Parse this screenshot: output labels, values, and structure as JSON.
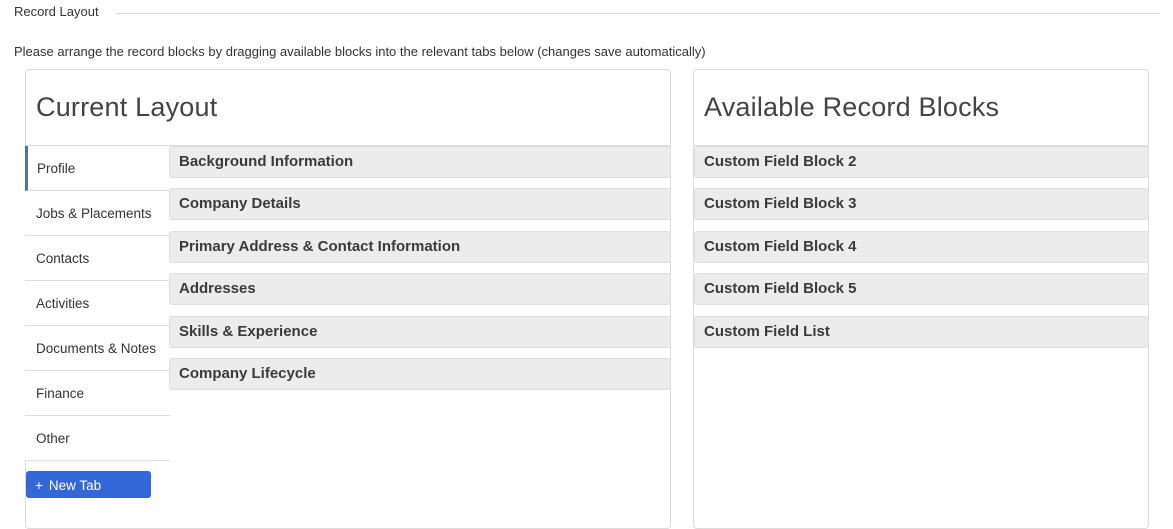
{
  "section": {
    "legend": "Record Layout",
    "instructions": "Please arrange the record blocks by dragging available blocks into the relevant tabs below (changes save automatically)"
  },
  "current_layout": {
    "title": "Current Layout",
    "tabs": [
      {
        "label": "Profile",
        "active": true
      },
      {
        "label": "Jobs & Placements",
        "active": false
      },
      {
        "label": "Contacts",
        "active": false
      },
      {
        "label": "Activities",
        "active": false
      },
      {
        "label": "Documents & Notes",
        "active": false
      },
      {
        "label": "Finance",
        "active": false
      },
      {
        "label": "Other",
        "active": false
      }
    ],
    "new_tab_button": {
      "icon": "+",
      "label": "New Tab"
    },
    "blocks": [
      "Background Information",
      "Company Details",
      "Primary Address & Contact Information",
      "Addresses",
      "Skills & Experience",
      "Company Lifecycle"
    ]
  },
  "available_blocks": {
    "title": "Available Record Blocks",
    "blocks": [
      "Custom Field Block 2",
      "Custom Field Block 3",
      "Custom Field Block 4",
      "Custom Field Block 5",
      "Custom Field List"
    ]
  },
  "colors": {
    "accent": "#3366d6",
    "active_tab_indicator": "#4a72c9",
    "block_background": "#ececec"
  }
}
